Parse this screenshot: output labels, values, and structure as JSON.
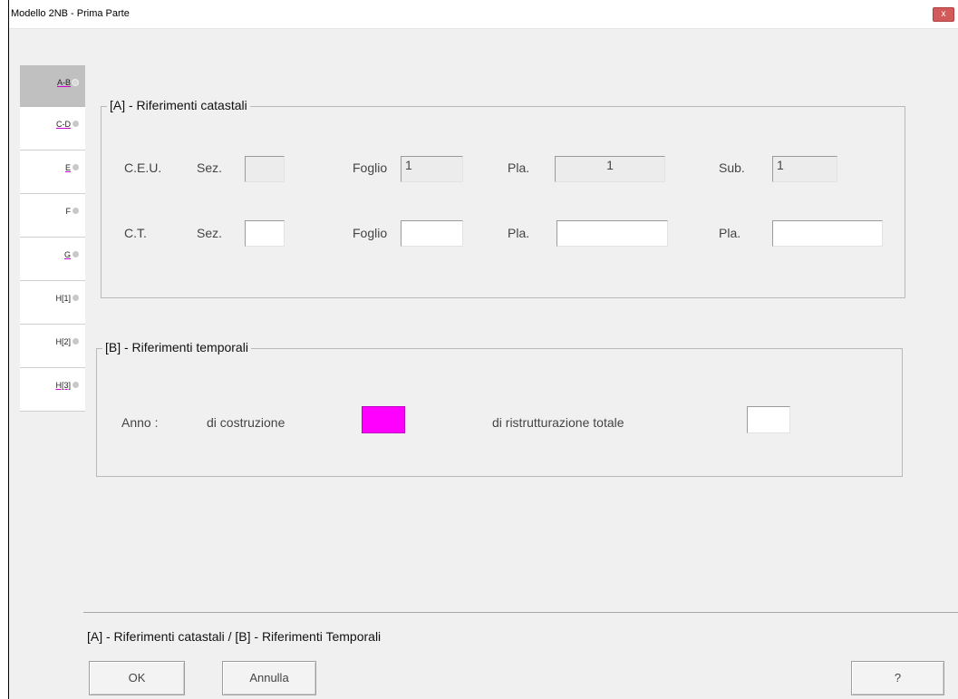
{
  "window": {
    "title": "Modello 2NB - Prima Parte",
    "close_label": "x"
  },
  "tabs": [
    {
      "label": "A-B"
    },
    {
      "label": "C-D"
    },
    {
      "label": "E"
    },
    {
      "label": "F"
    },
    {
      "label": "G"
    },
    {
      "label": "H[1]"
    },
    {
      "label": "H[2]"
    },
    {
      "label": "H[3]"
    }
  ],
  "group_a": {
    "title": "[A] - Riferimenti catastali",
    "ceu": {
      "label": "C.E.U.",
      "sez_label": "Sez.",
      "sez_value": "",
      "foglio_label": "Foglio",
      "foglio_value": "1",
      "pla_label": "Pla.",
      "pla_value": "1",
      "sub_label": "Sub.",
      "sub_value": "1"
    },
    "ct": {
      "label": "C.T.",
      "sez_label": "Sez.",
      "sez_value": "",
      "foglio_label": "Foglio",
      "foglio_value": "",
      "pla_label": "Pla.",
      "pla_value": "",
      "pla2_label": "Pla.",
      "pla2_value": ""
    }
  },
  "group_b": {
    "title": "[B] - Riferimenti temporali",
    "anno_label": "Anno :",
    "costruzione_label": "di costruzione",
    "costruzione_color": "#ff00ff",
    "ristrutturazione_label": "di ristrutturazione totale",
    "ristrutturazione_value": ""
  },
  "status": {
    "text": "[A] - Riferimenti catastali / [B] - Riferimenti Temporali"
  },
  "buttons": {
    "ok": "OK",
    "cancel": "Annulla",
    "help": "?"
  }
}
